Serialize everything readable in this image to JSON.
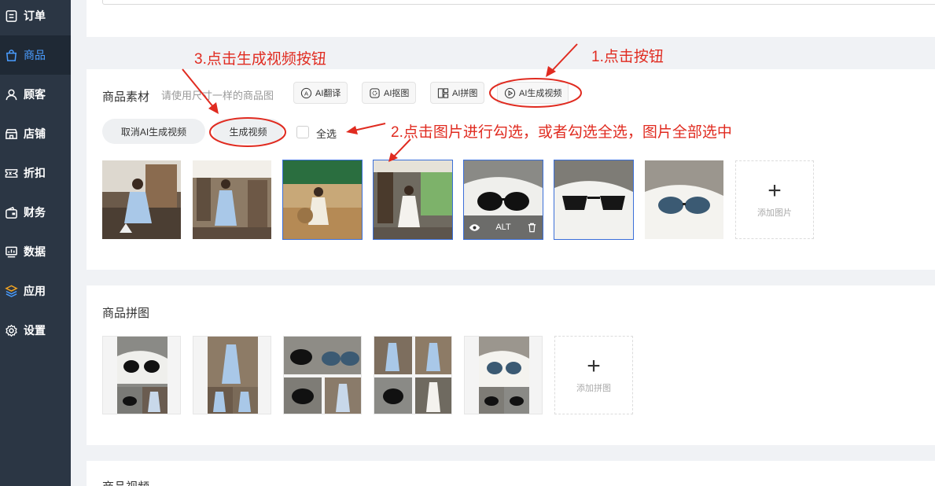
{
  "sidebar": {
    "items": [
      {
        "label": "订单",
        "icon": "order-icon",
        "active": false
      },
      {
        "label": "商品",
        "icon": "bag-icon",
        "active": true
      },
      {
        "label": "顾客",
        "icon": "user-icon",
        "active": false
      },
      {
        "label": "店铺",
        "icon": "shop-icon",
        "active": false
      },
      {
        "label": "折扣",
        "icon": "coupon-icon",
        "active": false
      },
      {
        "label": "财务",
        "icon": "wallet-icon",
        "active": false
      },
      {
        "label": "数据",
        "icon": "chart-icon",
        "active": false
      },
      {
        "label": "应用",
        "icon": "apps-icon",
        "active": false
      },
      {
        "label": "设置",
        "icon": "gear-icon",
        "active": false
      }
    ]
  },
  "materials": {
    "title": "商品素材",
    "hint": "请使用尺寸一样的商品图",
    "tools": {
      "translate": "AI翻译",
      "cutout": "AI抠图",
      "collage": "AI拼图",
      "video": "AI生成视频"
    },
    "cancel_label": "取消AI生成视频",
    "generate_label": "生成视频",
    "select_all_label": "全选",
    "hover_alt": "ALT",
    "add_image_label": "添加图片"
  },
  "collage_section": {
    "title": "商品拼图",
    "add_label": "添加拼图"
  },
  "video_section": {
    "title": "商品视频"
  },
  "annotations": {
    "step1": "1.点击按钮",
    "step2": "2.点击图片进行勾选，或者勾选全选，图片全部选中",
    "step3": "3.点击生成视频按钮"
  },
  "colors": {
    "sidebar_bg": "#2b3644",
    "active_accent": "#4a9dff",
    "annotation_red": "#e02b20",
    "selection_blue": "#3b6fd9"
  }
}
